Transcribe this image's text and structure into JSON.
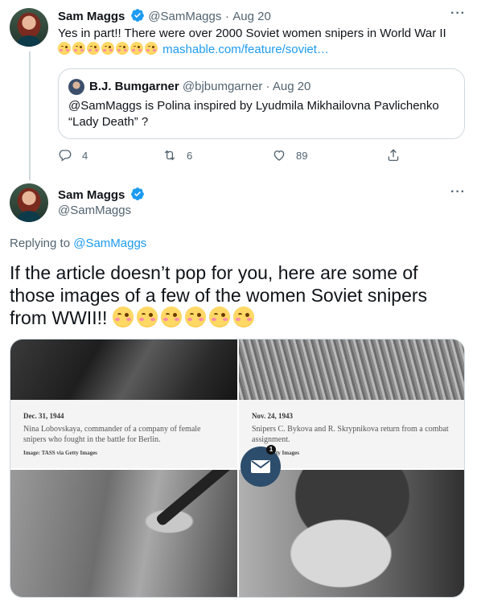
{
  "tweet1": {
    "name": "Sam Maggs",
    "handle": "@SamMaggs",
    "separator": "·",
    "date": "Aug 20",
    "text": "Yes in part!! There were over 2000 Soviet women snipers in World War II",
    "emoji_count": 7,
    "link": "mashable.com/feature/soviet…",
    "quote": {
      "name": "B.J. Bumgarner",
      "handle": "@bjbumgarner",
      "separator": "·",
      "date": "Aug 20",
      "text": "@SamMaggs is Polina inspired by Lyudmila Mikhailovna Pavlichenko “Lady Death” ?"
    },
    "actions": {
      "replies": "4",
      "retweets": "6",
      "likes": "89"
    }
  },
  "tweet2": {
    "name": "Sam Maggs",
    "handle": "@SamMaggs",
    "replying_prefix": "Replying to",
    "replying_to": "@SamMaggs",
    "text": "If the article doesn’t pop for you, here are some of those images of a few of the women Soviet snipers from WWII!!",
    "emoji_count": 6
  },
  "media": {
    "image1": {
      "date": "Dec. 31, 1944",
      "caption": "Nina Lobovskaya, commander of a company of female snipers who fought in the battle for Berlin.",
      "credit": "Image: TASS via Getty Images"
    },
    "image2": {
      "date": "Nov. 24, 1943",
      "caption": "Snipers C. Bykova and R. Skrypnikova return from a combat assignment.",
      "credit": "mann/Getty Images"
    },
    "mail_badge_count": "1"
  },
  "colors": {
    "accent": "#1d9bf0",
    "text": "#0f1419",
    "muted": "#536471",
    "border": "#cfd9de"
  }
}
